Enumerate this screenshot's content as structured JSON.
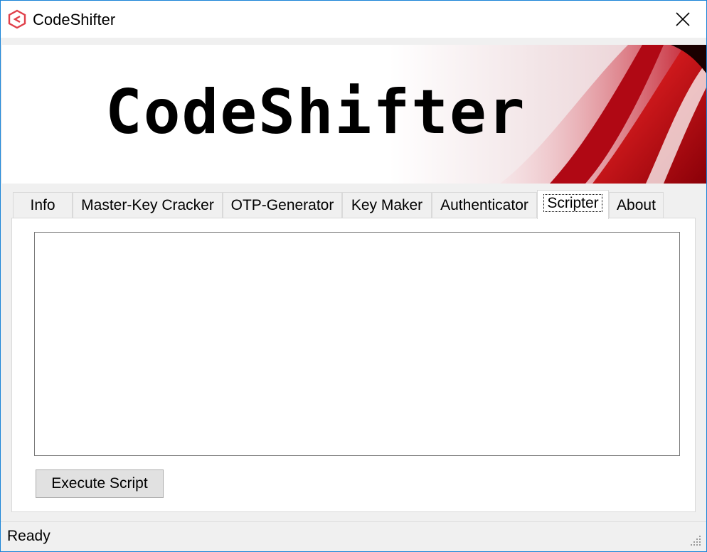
{
  "window": {
    "title": "CodeShifter",
    "app_icon": "codeshifter-logo-icon",
    "close_icon": "close-icon"
  },
  "banner": {
    "logo_text": "CodeShifter"
  },
  "tabs": [
    {
      "label": "Info",
      "active": false
    },
    {
      "label": "Master-Key Cracker",
      "active": false
    },
    {
      "label": "OTP-Generator",
      "active": false
    },
    {
      "label": "Key Maker",
      "active": false
    },
    {
      "label": "Authenticator",
      "active": false
    },
    {
      "label": "Scripter",
      "active": true
    },
    {
      "label": "About",
      "active": false
    }
  ],
  "scripter": {
    "script_text": "",
    "execute_label": "Execute Script"
  },
  "status": {
    "text": "Ready"
  },
  "colors": {
    "accent": "#1883d7",
    "brand_red": "#e0101a"
  }
}
